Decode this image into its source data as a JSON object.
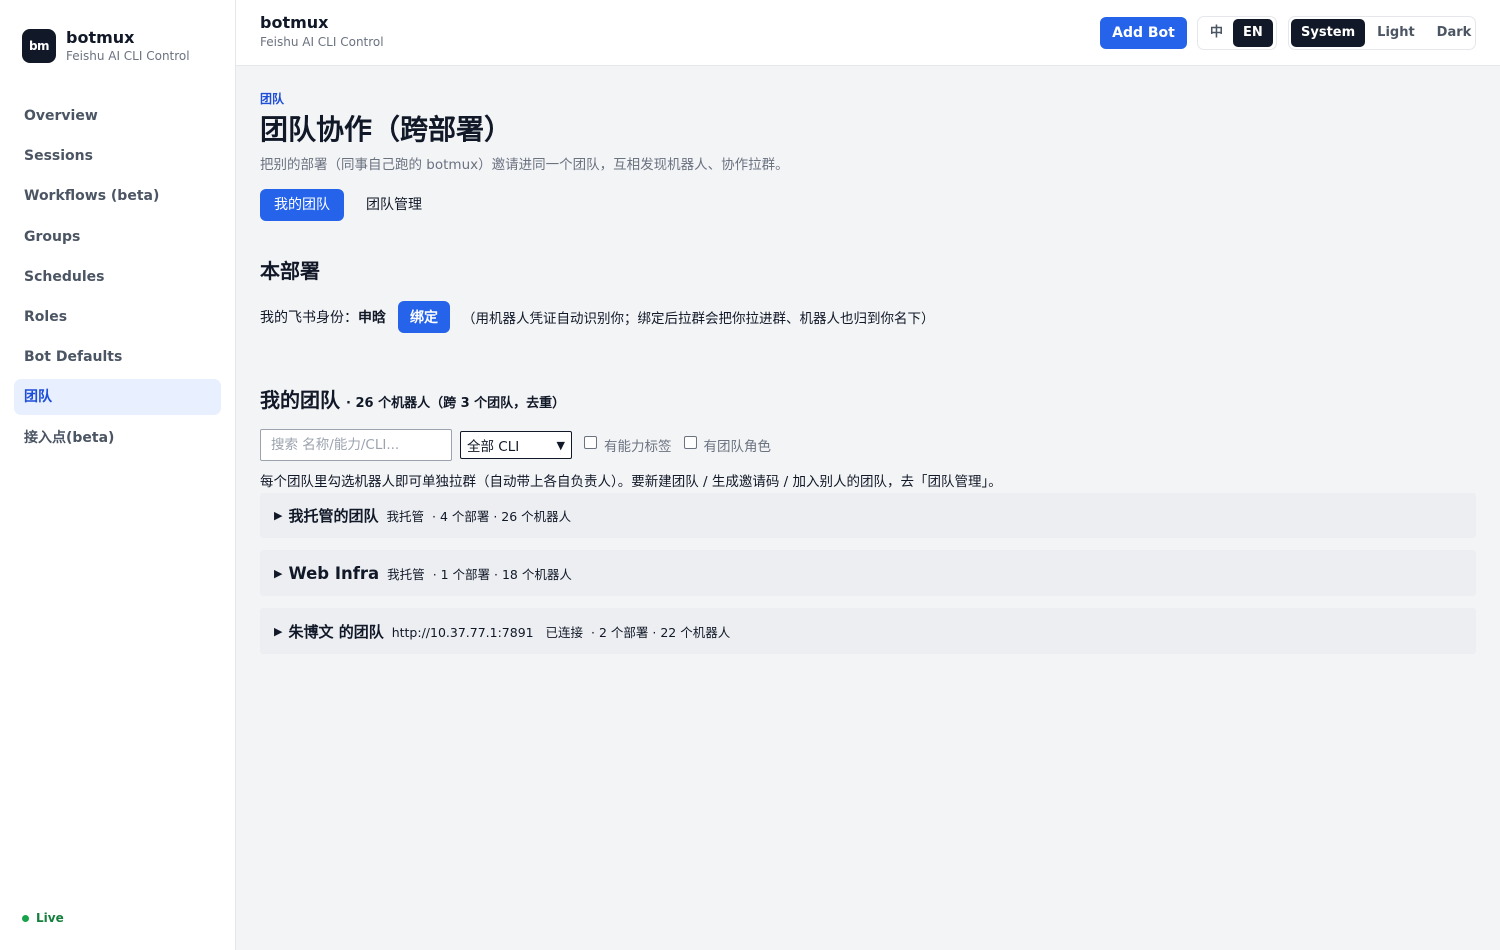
{
  "app": {
    "logo_text": "bm",
    "name": "botmux",
    "subtitle": "Feishu AI CLI Control"
  },
  "sidebar": {
    "items": [
      {
        "label": "Overview",
        "active": false
      },
      {
        "label": "Sessions",
        "active": false
      },
      {
        "label": "Workflows (beta)",
        "active": false
      },
      {
        "label": "Groups",
        "active": false
      },
      {
        "label": "Schedules",
        "active": false
      },
      {
        "label": "Roles",
        "active": false
      },
      {
        "label": "Bot Defaults",
        "active": false
      },
      {
        "label": "团队",
        "active": true
      },
      {
        "label": "接入点(beta)",
        "active": false
      }
    ],
    "status": "Live"
  },
  "header": {
    "title": "botmux",
    "subtitle": "Feishu AI CLI Control",
    "add_bot_label": "Add Bot",
    "language": {
      "options": [
        "中",
        "EN"
      ],
      "selected": "EN"
    },
    "theme": {
      "options": [
        "System",
        "Light",
        "Dark"
      ],
      "selected": "System"
    }
  },
  "page": {
    "eyebrow": "团队",
    "title": "团队协作（跨部署）",
    "description": "把别的部署（同事自己跑的 botmux）邀请进同一个团队，互相发现机器人、协作拉群。",
    "tabs": [
      {
        "label": "我的团队",
        "active": true
      },
      {
        "label": "团队管理",
        "active": false
      }
    ]
  },
  "deployment": {
    "heading": "本部署",
    "identity_label": "我的飞书身份：",
    "identity_name": "申晗",
    "bind_label": "绑定",
    "hint": "（用机器人凭证自动识别你；绑定后拉群会把你拉进群、机器人也归到你名下）"
  },
  "teams": {
    "heading": "我的团队",
    "count_text": "· 26 个机器人（跨 3 个团队，去重）",
    "search_placeholder": "搜索 名称/能力/CLI...",
    "cli_filter": {
      "selected": "全部 CLI"
    },
    "filter_capability": {
      "label": "有能力标签",
      "checked": false
    },
    "filter_role": {
      "label": "有团队角色",
      "checked": false
    },
    "help": "每个团队里勾选机器人即可单独拉群（自动带上各自负责人）。要新建团队 / 生成邀请码 / 加入别人的团队，去「团队管理」。",
    "list": [
      {
        "name": "我托管的团队",
        "meta": "我托管",
        "stats": "· 4 个部署 · 26 个机器人"
      },
      {
        "name": "Web Infra",
        "meta": "我托管",
        "stats": "· 1 个部署 · 18 个机器人"
      },
      {
        "name": "朱博文 的团队",
        "meta": "http://10.37.77.1:7891   已连接",
        "stats": "· 2 个部署 · 22 个机器人"
      }
    ]
  },
  "icons": {
    "expand": "triangle-right-icon",
    "select": "chevron-down-icon",
    "status": "dot-icon"
  },
  "colors": {
    "accent": "#2563eb",
    "active_nav_bg": "#e8efff",
    "live": "#16a34a"
  }
}
